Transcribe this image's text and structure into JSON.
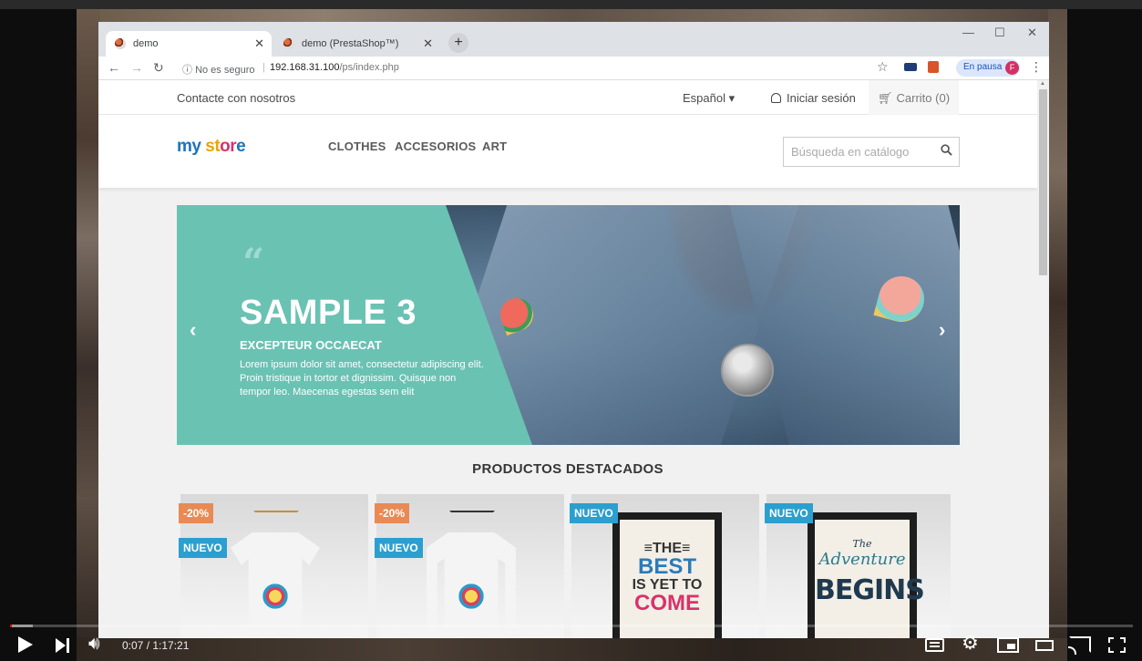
{
  "browser": {
    "tabs": [
      {
        "title": "demo",
        "active": true
      },
      {
        "title": "demo (PrestaShop™)",
        "active": false
      }
    ],
    "security_label": "No es seguro",
    "url_host": "192.168.31.100",
    "url_path": "/ps/index.php",
    "profile_status": "En pausa",
    "profile_initial": "F"
  },
  "store": {
    "top_nav": {
      "contact": "Contacte con nosotros",
      "language": "Español",
      "login": "Iniciar sesión",
      "cart": "Carrito (0)"
    },
    "logo": {
      "part1": "my",
      "part2": " st",
      "part3": "or",
      "part4": "e"
    },
    "categories": [
      "CLOTHES",
      "ACCESORIOS",
      "ART"
    ],
    "search": {
      "placeholder": "Búsqueda en catálogo"
    },
    "slider": {
      "title": "SAMPLE 3",
      "subtitle": "EXCEPTEUR OCCAECAT",
      "text": "Lorem ipsum dolor sit amet, consectetur adipiscing elit. Proin tristique in tortor et dignissim. Quisque non tempor leo. Maecenas egestas sem elit"
    },
    "featured_title": "PRODUCTOS DESTACADOS",
    "products": [
      {
        "badges": [
          "-20%",
          "NUEVO"
        ],
        "kind": "tshirt"
      },
      {
        "badges": [
          "-20%",
          "NUEVO"
        ],
        "kind": "sweater"
      },
      {
        "badges": [
          "NUEVO"
        ],
        "kind": "poster",
        "poster_lines": [
          "≡THE≡",
          "BEST",
          "IS YET TO",
          "COME"
        ]
      },
      {
        "badges": [
          "NUEVO"
        ],
        "kind": "poster",
        "poster_lines": [
          "The",
          "Adventure",
          "BEGINS"
        ]
      }
    ]
  },
  "player": {
    "time": "0:07 / 1:17:21",
    "progress_fraction": 0.0015,
    "buffered_fraction": 0.02,
    "colors": {
      "played": "#ff0000"
    }
  }
}
